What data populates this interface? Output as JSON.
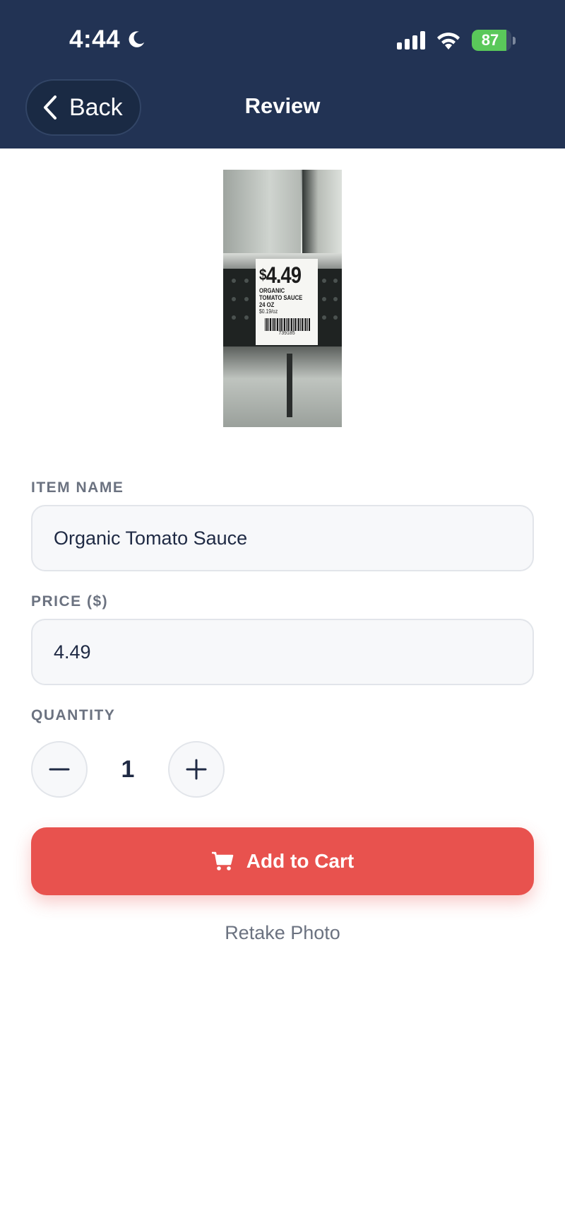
{
  "status_bar": {
    "time": "4:44",
    "battery": "87",
    "battery_level": 0.87,
    "icons": [
      "moon-icon",
      "signal-icon",
      "wifi-icon",
      "battery-icon"
    ]
  },
  "header": {
    "back_label": "Back",
    "title": "Review"
  },
  "photo": {
    "tag_price_symbol": "$",
    "tag_price": "4.49",
    "tag_line1": "ORGANIC",
    "tag_line2": "TOMATO SAUCE",
    "tag_line3": "24 OZ",
    "tag_unit_price": "$0.19/oz",
    "tag_barcode_number": "739185"
  },
  "form": {
    "item_name_label": "ITEM NAME",
    "item_name_value": "Organic Tomato Sauce",
    "price_label": "PRICE ($)",
    "price_value": "4.49",
    "quantity_label": "QUANTITY",
    "quantity_value": "1"
  },
  "actions": {
    "add_to_cart_label": "Add to Cart",
    "retake_label": "Retake Photo"
  },
  "colors": {
    "header_bg": "#223354",
    "accent": "#e8524e",
    "battery": "#5ac85a"
  }
}
